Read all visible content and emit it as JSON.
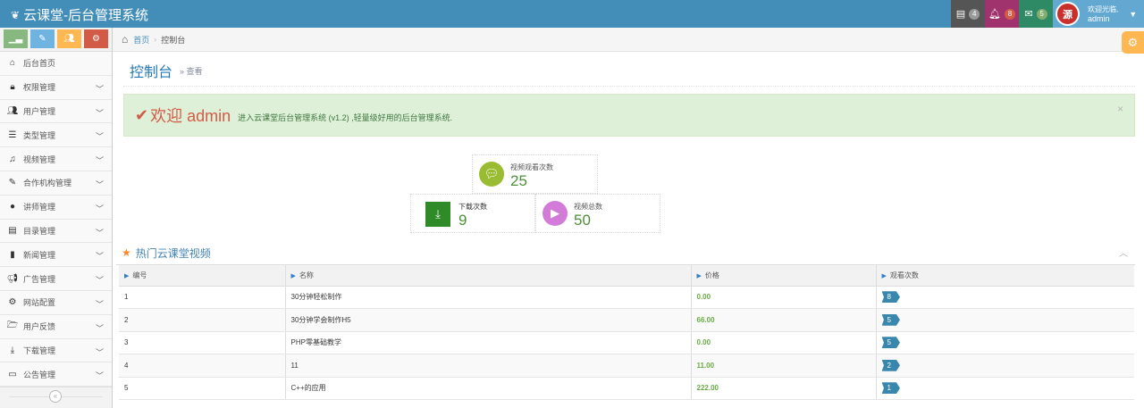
{
  "navbar": {
    "brand": "云课堂-后台管理系统",
    "tasks_count": "4",
    "notifications_count": "8",
    "messages_count": "5",
    "user_greeting": "欢迎光临,",
    "user_name": "admin",
    "avatar_text": "源"
  },
  "sidebar": {
    "items": [
      {
        "label": "后台首页",
        "icon": "home-icon"
      },
      {
        "label": "权限管理",
        "icon": "lock-icon"
      },
      {
        "label": "用户管理",
        "icon": "users-icon"
      },
      {
        "label": "类型管理",
        "icon": "list-icon"
      },
      {
        "label": "视频管理",
        "icon": "music-icon"
      },
      {
        "label": "合作机构管理",
        "icon": "edit-icon"
      },
      {
        "label": "讲师管理",
        "icon": "user-icon"
      },
      {
        "label": "目录管理",
        "icon": "list-alt-icon"
      },
      {
        "label": "新闻管理",
        "icon": "file-icon"
      },
      {
        "label": "广告管理",
        "icon": "bullhorn-icon"
      },
      {
        "label": "网站配置",
        "icon": "cogs-icon"
      },
      {
        "label": "用户反馈",
        "icon": "folder-open-icon"
      },
      {
        "label": "下载管理",
        "icon": "download-icon"
      },
      {
        "label": "公告管理",
        "icon": "credit-card-icon"
      }
    ]
  },
  "breadcrumb": {
    "home": "首页",
    "current": "控制台"
  },
  "page": {
    "title": "控制台",
    "subtitle": "» 查看"
  },
  "alert": {
    "welcome": "欢迎 admin",
    "message": "进入云课堂后台管理系统 (v1.2) ,轻量级好用的后台管理系统."
  },
  "stats": {
    "views": {
      "label": "视频观看次数",
      "value": "25",
      "color": "#9abc32"
    },
    "downloads": {
      "label": "下载次数",
      "value": "9",
      "color": "#2e8b28"
    },
    "videos": {
      "label": "视频总数",
      "value": "50",
      "color": "#d27bd8"
    }
  },
  "hot": {
    "title": "热门云课堂视频",
    "columns": [
      "编号",
      "名称",
      "价格",
      "观看次数"
    ],
    "rows": [
      {
        "id": "1",
        "name": "30分钟轻松制作",
        "price": "0.00",
        "views": "8"
      },
      {
        "id": "2",
        "name": "30分钟学会制作H5",
        "price": "66.00",
        "views": "5"
      },
      {
        "id": "3",
        "name": "PHP零基础教学",
        "price": "0.00",
        "views": "5"
      },
      {
        "id": "4",
        "name": "11",
        "price": "11.00",
        "views": "2"
      },
      {
        "id": "5",
        "name": "C++的应用",
        "price": "222.00",
        "views": "1"
      }
    ]
  }
}
